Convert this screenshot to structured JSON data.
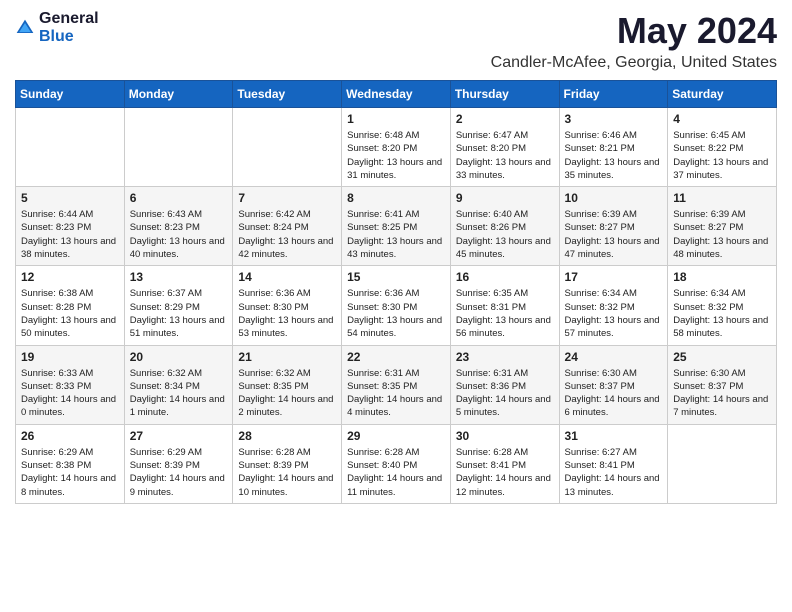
{
  "logo": {
    "general": "General",
    "blue": "Blue"
  },
  "title": {
    "month": "May 2024",
    "location": "Candler-McAfee, Georgia, United States"
  },
  "days_of_week": [
    "Sunday",
    "Monday",
    "Tuesday",
    "Wednesday",
    "Thursday",
    "Friday",
    "Saturday"
  ],
  "weeks": [
    [
      {
        "date": "",
        "info": ""
      },
      {
        "date": "",
        "info": ""
      },
      {
        "date": "",
        "info": ""
      },
      {
        "date": "1",
        "info": "Sunrise: 6:48 AM\nSunset: 8:20 PM\nDaylight: 13 hours and 31 minutes."
      },
      {
        "date": "2",
        "info": "Sunrise: 6:47 AM\nSunset: 8:20 PM\nDaylight: 13 hours and 33 minutes."
      },
      {
        "date": "3",
        "info": "Sunrise: 6:46 AM\nSunset: 8:21 PM\nDaylight: 13 hours and 35 minutes."
      },
      {
        "date": "4",
        "info": "Sunrise: 6:45 AM\nSunset: 8:22 PM\nDaylight: 13 hours and 37 minutes."
      }
    ],
    [
      {
        "date": "5",
        "info": "Sunrise: 6:44 AM\nSunset: 8:23 PM\nDaylight: 13 hours and 38 minutes."
      },
      {
        "date": "6",
        "info": "Sunrise: 6:43 AM\nSunset: 8:23 PM\nDaylight: 13 hours and 40 minutes."
      },
      {
        "date": "7",
        "info": "Sunrise: 6:42 AM\nSunset: 8:24 PM\nDaylight: 13 hours and 42 minutes."
      },
      {
        "date": "8",
        "info": "Sunrise: 6:41 AM\nSunset: 8:25 PM\nDaylight: 13 hours and 43 minutes."
      },
      {
        "date": "9",
        "info": "Sunrise: 6:40 AM\nSunset: 8:26 PM\nDaylight: 13 hours and 45 minutes."
      },
      {
        "date": "10",
        "info": "Sunrise: 6:39 AM\nSunset: 8:27 PM\nDaylight: 13 hours and 47 minutes."
      },
      {
        "date": "11",
        "info": "Sunrise: 6:39 AM\nSunset: 8:27 PM\nDaylight: 13 hours and 48 minutes."
      }
    ],
    [
      {
        "date": "12",
        "info": "Sunrise: 6:38 AM\nSunset: 8:28 PM\nDaylight: 13 hours and 50 minutes."
      },
      {
        "date": "13",
        "info": "Sunrise: 6:37 AM\nSunset: 8:29 PM\nDaylight: 13 hours and 51 minutes."
      },
      {
        "date": "14",
        "info": "Sunrise: 6:36 AM\nSunset: 8:30 PM\nDaylight: 13 hours and 53 minutes."
      },
      {
        "date": "15",
        "info": "Sunrise: 6:36 AM\nSunset: 8:30 PM\nDaylight: 13 hours and 54 minutes."
      },
      {
        "date": "16",
        "info": "Sunrise: 6:35 AM\nSunset: 8:31 PM\nDaylight: 13 hours and 56 minutes."
      },
      {
        "date": "17",
        "info": "Sunrise: 6:34 AM\nSunset: 8:32 PM\nDaylight: 13 hours and 57 minutes."
      },
      {
        "date": "18",
        "info": "Sunrise: 6:34 AM\nSunset: 8:32 PM\nDaylight: 13 hours and 58 minutes."
      }
    ],
    [
      {
        "date": "19",
        "info": "Sunrise: 6:33 AM\nSunset: 8:33 PM\nDaylight: 14 hours and 0 minutes."
      },
      {
        "date": "20",
        "info": "Sunrise: 6:32 AM\nSunset: 8:34 PM\nDaylight: 14 hours and 1 minute."
      },
      {
        "date": "21",
        "info": "Sunrise: 6:32 AM\nSunset: 8:35 PM\nDaylight: 14 hours and 2 minutes."
      },
      {
        "date": "22",
        "info": "Sunrise: 6:31 AM\nSunset: 8:35 PM\nDaylight: 14 hours and 4 minutes."
      },
      {
        "date": "23",
        "info": "Sunrise: 6:31 AM\nSunset: 8:36 PM\nDaylight: 14 hours and 5 minutes."
      },
      {
        "date": "24",
        "info": "Sunrise: 6:30 AM\nSunset: 8:37 PM\nDaylight: 14 hours and 6 minutes."
      },
      {
        "date": "25",
        "info": "Sunrise: 6:30 AM\nSunset: 8:37 PM\nDaylight: 14 hours and 7 minutes."
      }
    ],
    [
      {
        "date": "26",
        "info": "Sunrise: 6:29 AM\nSunset: 8:38 PM\nDaylight: 14 hours and 8 minutes."
      },
      {
        "date": "27",
        "info": "Sunrise: 6:29 AM\nSunset: 8:39 PM\nDaylight: 14 hours and 9 minutes."
      },
      {
        "date": "28",
        "info": "Sunrise: 6:28 AM\nSunset: 8:39 PM\nDaylight: 14 hours and 10 minutes."
      },
      {
        "date": "29",
        "info": "Sunrise: 6:28 AM\nSunset: 8:40 PM\nDaylight: 14 hours and 11 minutes."
      },
      {
        "date": "30",
        "info": "Sunrise: 6:28 AM\nSunset: 8:41 PM\nDaylight: 14 hours and 12 minutes."
      },
      {
        "date": "31",
        "info": "Sunrise: 6:27 AM\nSunset: 8:41 PM\nDaylight: 14 hours and 13 minutes."
      },
      {
        "date": "",
        "info": ""
      }
    ]
  ]
}
